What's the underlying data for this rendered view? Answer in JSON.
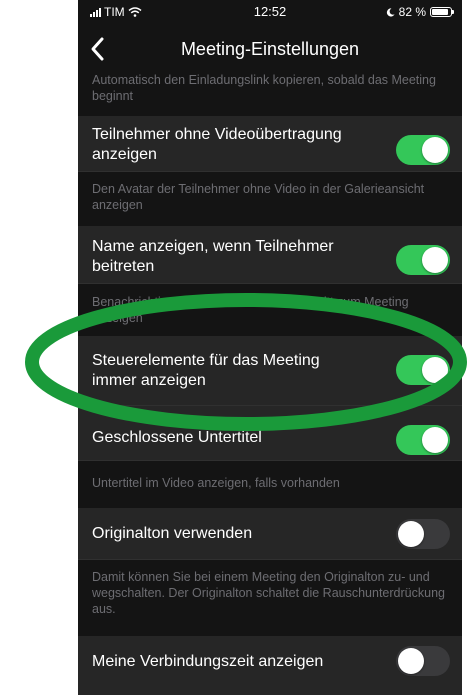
{
  "status_bar": {
    "carrier": "TIM",
    "time": "12:52",
    "battery": "82 %"
  },
  "nav": {
    "title": "Meeting-Einstellungen"
  },
  "top_desc": "Automatisch den Einladungslink kopieren, sobald das Meeting beginnt",
  "settings": [
    {
      "label": "Teilnehmer ohne Videoübertragung anzeigen",
      "on": true,
      "desc": "Den Avatar der Teilnehmer ohne Video in der Galerieansicht anzeigen"
    },
    {
      "label": "Name anzeigen, wenn Teilnehmer beitreten",
      "on": true,
      "desc": "Benachrichtigung der Teilnehmer bei Beitritt zum Meeting anzeigen"
    },
    {
      "label": "Steuerelemente für das Meeting immer anzeigen",
      "on": true,
      "desc": ""
    },
    {
      "label": "Geschlossene Untertitel",
      "on": true,
      "desc": "Untertitel im Video anzeigen, falls vorhanden"
    },
    {
      "label": "Originalton verwenden",
      "on": false,
      "desc": "Damit können Sie bei einem Meeting den Originalton zu- und wegschalten. Der Originalton schaltet die Rauschunterdrückung aus."
    },
    {
      "label": "Meine Verbindungszeit anzeigen",
      "on": false,
      "desc": ""
    }
  ],
  "colors": {
    "toggle_on": "#34c759",
    "annotation": "#1a9a3a",
    "background": "#141414"
  }
}
